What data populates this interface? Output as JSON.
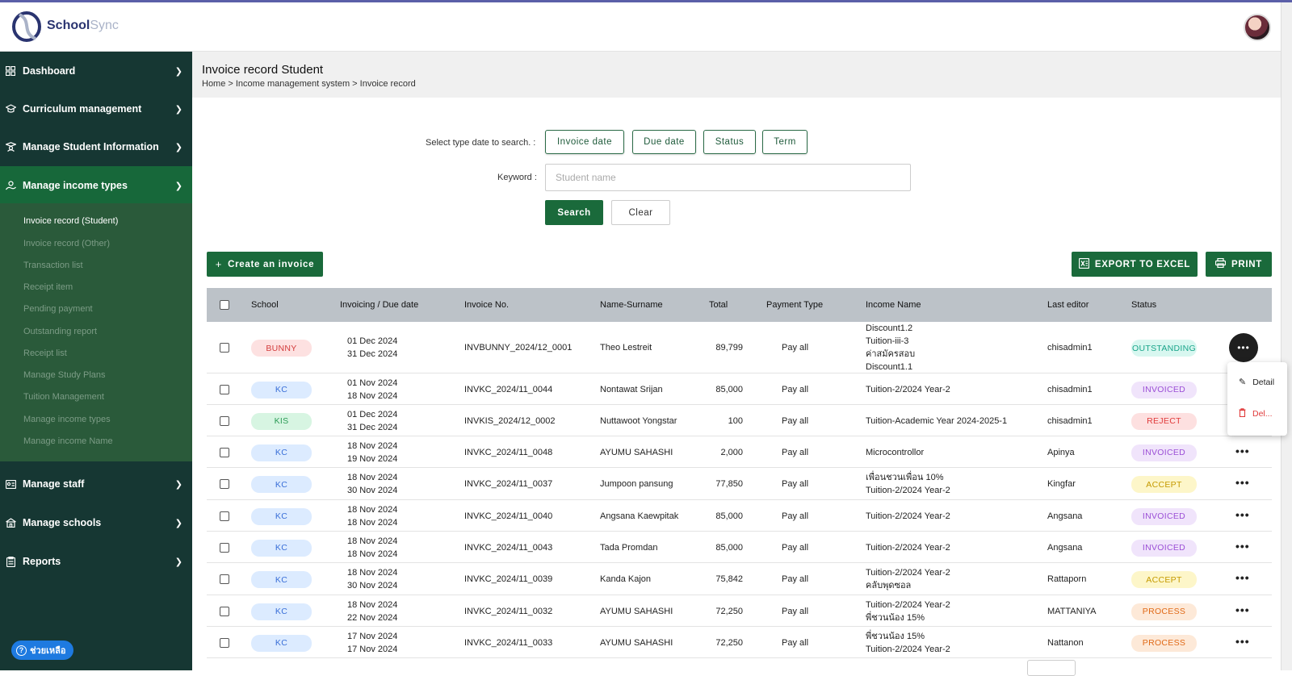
{
  "app": {
    "name_a": "School",
    "name_b": "Sync"
  },
  "sidebar": {
    "items": [
      {
        "label": "Dashboard",
        "icon": "grid-icon"
      },
      {
        "label": "Curriculum management",
        "icon": "graduation-cap-icon"
      },
      {
        "label": "Manage Student Information",
        "icon": "student-icon"
      },
      {
        "label": "Manage income types",
        "icon": "money-icon"
      },
      {
        "label": "Manage staff",
        "icon": "id-card-icon"
      },
      {
        "label": "Manage schools",
        "icon": "school-icon"
      },
      {
        "label": "Reports",
        "icon": "clipboard-icon"
      }
    ],
    "submenu": [
      "Invoice record (Student)",
      "Invoice record (Other)",
      "Transaction list",
      "Receipt item",
      "Pending payment",
      "Outstanding report",
      "Receipt list",
      "Manage Study Plans",
      "Tuition Management",
      "Manage income types",
      "Manage income Name"
    ],
    "help": "ช่วยเหลือ"
  },
  "page": {
    "title": "Invoice record Student",
    "breadcrumb": "Home > Income management system > Invoice record"
  },
  "filters": {
    "type_label": "Select type date to search. :",
    "type_buttons": [
      "Invoice date",
      "Due date",
      "Status",
      "Term"
    ],
    "keyword_label": "Keyword :",
    "keyword_placeholder": "Student name",
    "keyword_value": "",
    "search": "Search",
    "clear": "Clear"
  },
  "actions": {
    "create": "Create an invoice",
    "export": "EXPORT TO EXCEL",
    "print": "PRINT"
  },
  "table": {
    "headers": [
      "School",
      "Invoicing / Due date",
      "Invoice No.",
      "Name-Surname",
      "Total",
      "Payment Type",
      "Income Name",
      "Last editor",
      "Status"
    ],
    "rows": [
      {
        "school": "BUNNY",
        "date1": "01 Dec 2024",
        "date2": "31 Dec 2024",
        "invoice": "INVBUNNY_2024/12_0001",
        "name": "Theo Lestreit",
        "total": "89,799",
        "payment": "Pay all",
        "income": [
          "Discount1.2",
          "Tuition-iii-3",
          "ค่าสมัครสอบ",
          "Discount1.1"
        ],
        "editor": "chisadmin1",
        "status": "OUTSTANDING"
      },
      {
        "school": "KC",
        "date1": "01 Nov 2024",
        "date2": "18 Nov 2024",
        "invoice": "INVKC_2024/11_0044",
        "name": "Nontawat Srijan",
        "total": "85,000",
        "payment": "Pay all",
        "income": [
          "Tuition-2/2024 Year-2"
        ],
        "editor": "chisadmin1",
        "status": "INVOICED"
      },
      {
        "school": "KIS",
        "date1": "01 Dec 2024",
        "date2": "31 Dec 2024",
        "invoice": "INVKIS_2024/12_0002",
        "name": "Nuttawoot Yongstar",
        "total": "100",
        "payment": "Pay all",
        "income": [
          "Tuition-Academic Year 2024-2025-1"
        ],
        "editor": "chisadmin1",
        "status": "REJECT"
      },
      {
        "school": "KC",
        "date1": "18 Nov 2024",
        "date2": "19 Nov 2024",
        "invoice": "INVKC_2024/11_0048",
        "name": "AYUMU SAHASHI",
        "total": "2,000",
        "payment": "Pay all",
        "income": [
          "Microcontrollor"
        ],
        "editor": "Apinya",
        "status": "INVOICED"
      },
      {
        "school": "KC",
        "date1": "18 Nov 2024",
        "date2": "30 Nov 2024",
        "invoice": "INVKC_2024/11_0037",
        "name": "Jumpoon pansung",
        "total": "77,850",
        "payment": "Pay all",
        "income": [
          "เพื่อนชวนเพื่อน 10%",
          "Tuition-2/2024 Year-2"
        ],
        "editor": "Kingfar",
        "status": "ACCEPT"
      },
      {
        "school": "KC",
        "date1": "18 Nov 2024",
        "date2": "18 Nov 2024",
        "invoice": "INVKC_2024/11_0040",
        "name": "Angsana Kaewpitak",
        "total": "85,000",
        "payment": "Pay all",
        "income": [
          "Tuition-2/2024 Year-2"
        ],
        "editor": "Angsana",
        "status": "INVOICED"
      },
      {
        "school": "KC",
        "date1": "18 Nov 2024",
        "date2": "18 Nov 2024",
        "invoice": "INVKC_2024/11_0043",
        "name": "Tada Promdan",
        "total": "85,000",
        "payment": "Pay all",
        "income": [
          "Tuition-2/2024 Year-2"
        ],
        "editor": "Angsana",
        "status": "INVOICED"
      },
      {
        "school": "KC",
        "date1": "18 Nov 2024",
        "date2": "30 Nov 2024",
        "invoice": "INVKC_2024/11_0039",
        "name": "Kanda Kajon",
        "total": "75,842",
        "payment": "Pay all",
        "income": [
          "Tuition-2/2024 Year-2",
          "คลับพุดซอล"
        ],
        "editor": "Rattaporn",
        "status": "ACCEPT"
      },
      {
        "school": "KC",
        "date1": "18 Nov 2024",
        "date2": "22 Nov 2024",
        "invoice": "INVKC_2024/11_0032",
        "name": "AYUMU SAHASHI",
        "total": "72,250",
        "payment": "Pay all",
        "income": [
          "Tuition-2/2024 Year-2",
          "พี่ชวนน้อง 15%"
        ],
        "editor": "MATTANIYA",
        "status": "PROCESS"
      },
      {
        "school": "KC",
        "date1": "17 Nov 2024",
        "date2": "17 Nov 2024",
        "invoice": "INVKC_2024/11_0033",
        "name": "AYUMU SAHASHI",
        "total": "72,250",
        "payment": "Pay all",
        "income": [
          "พี่ชวนน้อง 15%",
          "Tuition-2/2024 Year-2"
        ],
        "editor": "Nattanon",
        "status": "PROCESS"
      }
    ]
  },
  "row_menu": {
    "detail": "Detail",
    "delete": "Del..."
  },
  "colors": {
    "sidebar": "#163733",
    "sidebar_active": "#17683a",
    "submenu": "#2a5a3a",
    "primary": "#1a6a3b",
    "table_header": "#bcc2c8"
  },
  "school_colors": {
    "BUNNY": {
      "bg": "#fde1e1",
      "fg": "#d33b3b"
    },
    "KC": {
      "bg": "#dcebff",
      "fg": "#3a6fd8"
    },
    "KIS": {
      "bg": "#d7f5e2",
      "fg": "#2a9a55"
    }
  },
  "status_colors": {
    "OUTSTANDING": {
      "bg": "#d8f7f0",
      "fg": "#1aa58a"
    },
    "INVOICED": {
      "bg": "#f0e4fb",
      "fg": "#9b4fd6"
    },
    "REJECT": {
      "bg": "#fde0e0",
      "fg": "#e03a3a"
    },
    "ACCEPT": {
      "bg": "#fdf6c9",
      "fg": "#c59a00"
    },
    "PROCESS": {
      "bg": "#fde9d8",
      "fg": "#e06a18"
    }
  }
}
